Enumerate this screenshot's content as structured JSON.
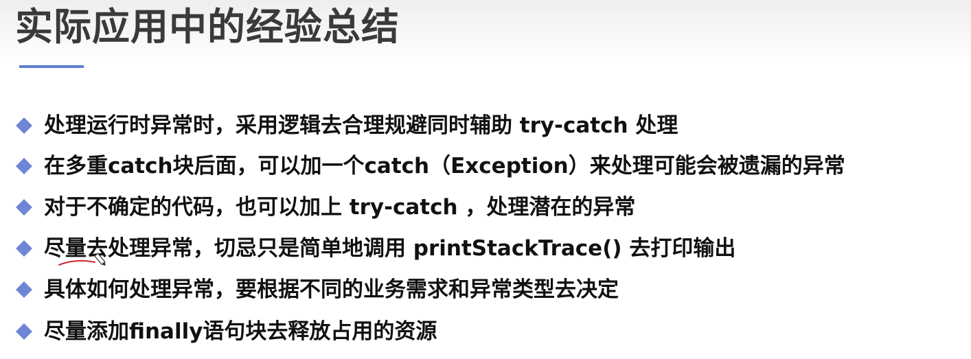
{
  "page": {
    "title": "实际应用中的经验总结",
    "accent_color": "#5a7bd0",
    "bullet_color": "#6f86d6"
  },
  "bullets": [
    {
      "icon": "diamond-bullet-icon",
      "text": "处理运行时异常时，采用逻辑去合理规避同时辅助 try-catch 处理"
    },
    {
      "icon": "diamond-bullet-icon",
      "text": "在多重catch块后面，可以加一个catch（Exception）来处理可能会被遗漏的异常"
    },
    {
      "icon": "diamond-bullet-icon",
      "text": "对于不确定的代码，也可以加上 try-catch ，处理潜在的异常"
    },
    {
      "icon": "diamond-bullet-icon",
      "text": "尽量去处理异常，切忌只是简单地调用 printStackTrace() 去打印输出"
    },
    {
      "icon": "diamond-bullet-icon",
      "text": "具体如何处理异常，要根据不同的业务需求和异常类型去决定"
    },
    {
      "icon": "diamond-bullet-icon",
      "text": "尽量添加finally语句块去释放占用的资源"
    }
  ]
}
